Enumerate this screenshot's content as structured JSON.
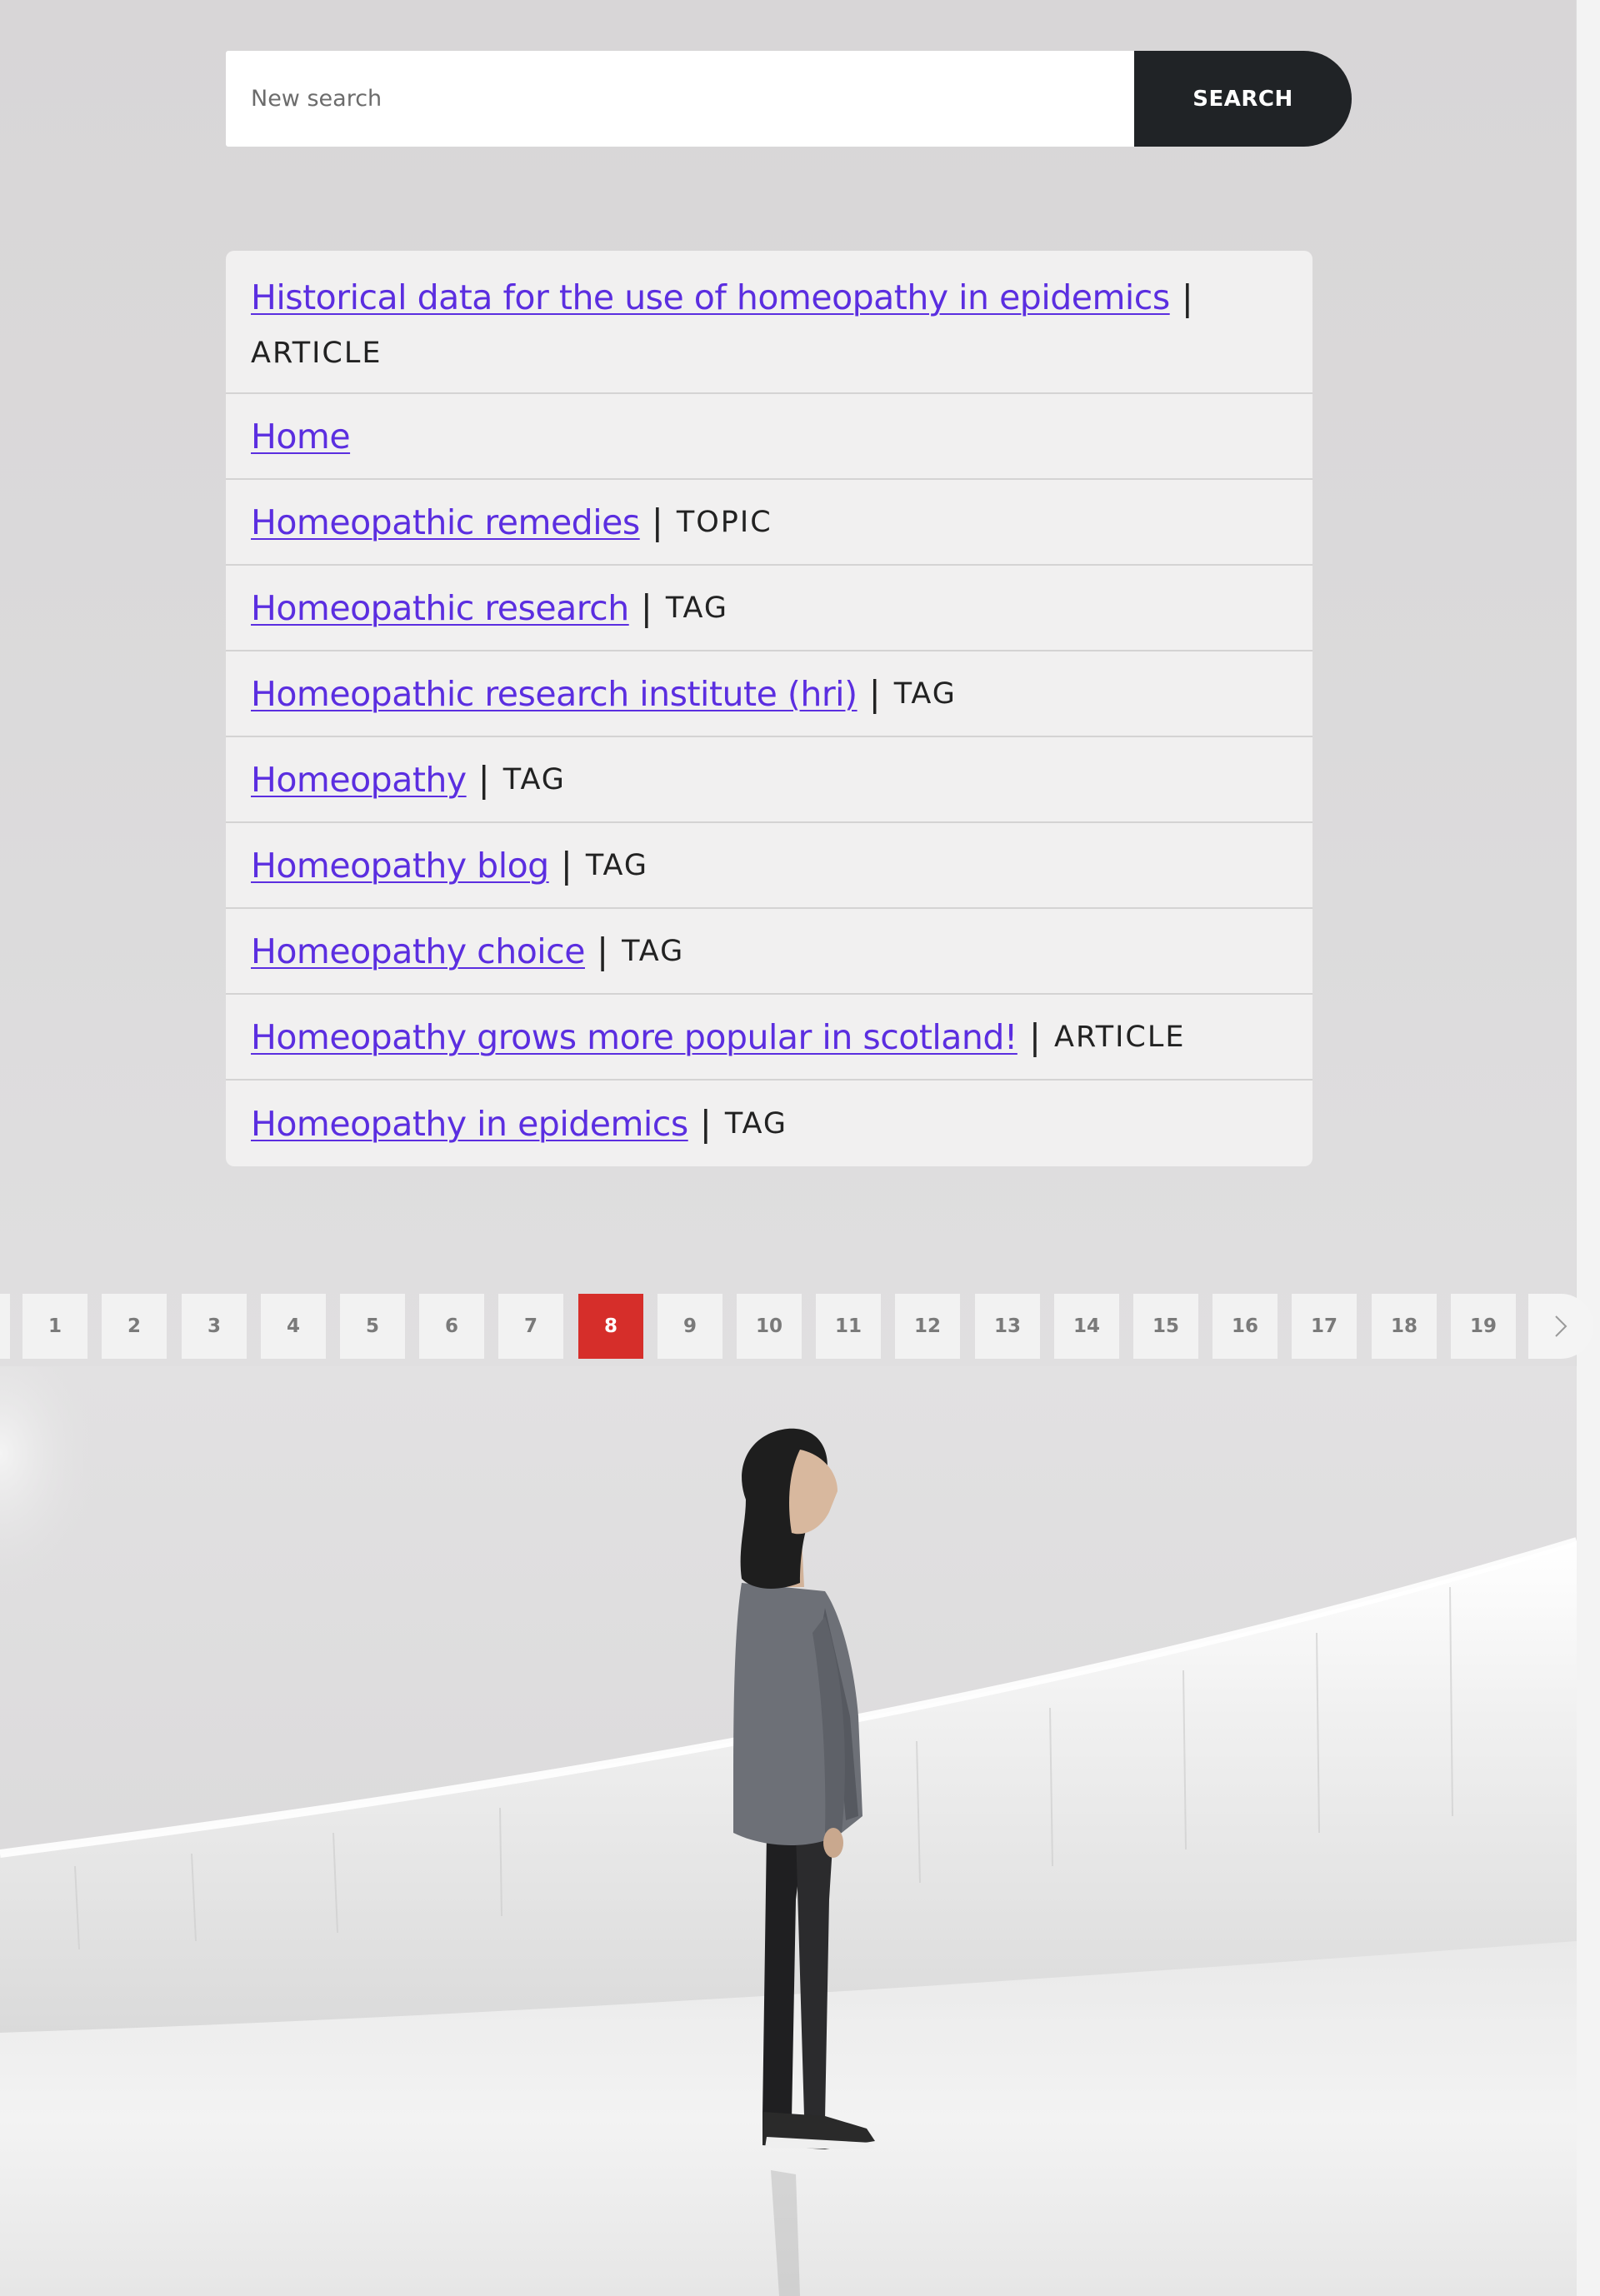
{
  "search": {
    "placeholder": "New search",
    "button_label": "SEARCH"
  },
  "results": [
    {
      "title": "Historical data for the use of homeopathy in epidemics",
      "type": "ARTICLE"
    },
    {
      "title": "Home",
      "type": ""
    },
    {
      "title": "Homeopathic remedies",
      "type": "TOPIC"
    },
    {
      "title": "Homeopathic research",
      "type": "TAG"
    },
    {
      "title": "Homeopathic research institute (hri)",
      "type": "TAG"
    },
    {
      "title": "Homeopathy",
      "type": "TAG"
    },
    {
      "title": "Homeopathy blog",
      "type": "TAG"
    },
    {
      "title": "Homeopathy choice",
      "type": "TAG"
    },
    {
      "title": "Homeopathy grows more popular in scotland!",
      "type": "ARTICLE"
    },
    {
      "title": "Homeopathy in epidemics",
      "type": "TAG"
    }
  ],
  "separator": "|",
  "pagination": {
    "pages": [
      "1",
      "2",
      "3",
      "4",
      "5",
      "6",
      "7",
      "8",
      "9",
      "10",
      "11",
      "12",
      "13",
      "14",
      "15",
      "16",
      "17",
      "18",
      "19"
    ],
    "current": "8",
    "next_icon": "chevron-right-icon"
  },
  "colors": {
    "link": "#5b2ee0",
    "search_button": "#202326",
    "active_page": "#d62e2a"
  }
}
